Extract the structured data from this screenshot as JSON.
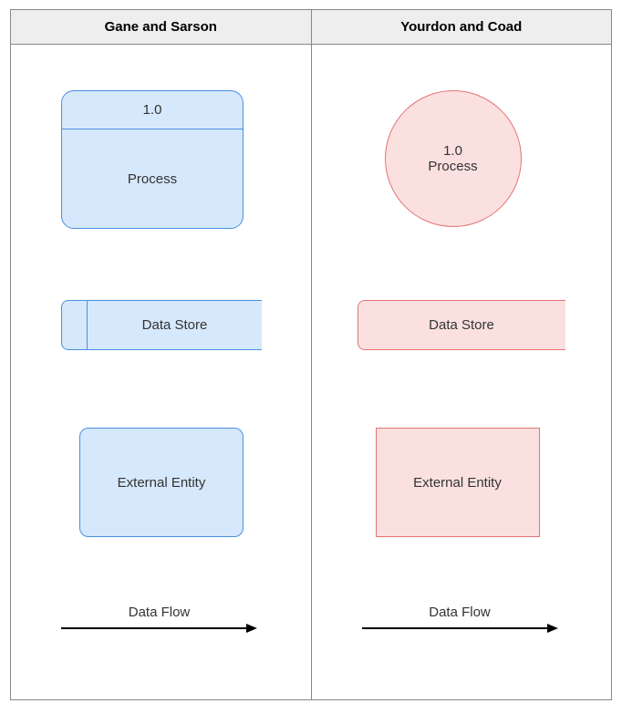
{
  "headers": {
    "left": "Gane and Sarson",
    "right": "Yourdon and Coad"
  },
  "gs": {
    "process_id": "1.0",
    "process_label": "Process",
    "datastore_label": "Data Store",
    "entity_label": "External Entity",
    "dataflow_label": "Data Flow"
  },
  "yc": {
    "process_id": "1.0",
    "process_label": "Process",
    "datastore_label": "Data Store",
    "entity_label": "External Entity",
    "dataflow_label": "Data Flow"
  }
}
